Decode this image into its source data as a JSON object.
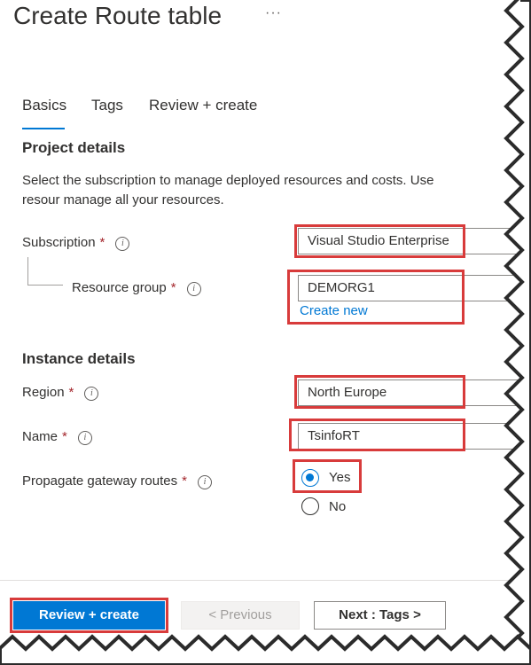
{
  "header": {
    "title": "Create Route table",
    "more": "···"
  },
  "tabs": [
    {
      "label": "Basics",
      "active": true
    },
    {
      "label": "Tags",
      "active": false
    },
    {
      "label": "Review + create",
      "active": false
    }
  ],
  "project": {
    "heading": "Project details",
    "description": "Select the subscription to manage deployed resources and costs. Use resour manage all your resources.",
    "subscription": {
      "label": "Subscription",
      "value": "Visual Studio Enterprise"
    },
    "resource_group": {
      "label": "Resource group",
      "value": "DEMORG1",
      "create_new": "Create new"
    }
  },
  "instance": {
    "heading": "Instance details",
    "region": {
      "label": "Region",
      "value": "North Europe"
    },
    "name": {
      "label": "Name",
      "value": "TsinfoRT"
    },
    "propagate": {
      "label": "Propagate gateway routes",
      "options": [
        "Yes",
        "No"
      ],
      "selected": "Yes"
    }
  },
  "common": {
    "required": "*",
    "info": "i"
  },
  "footer": {
    "review_create": "Review + create",
    "previous": "< Previous",
    "next": "Next : Tags >"
  },
  "colors": {
    "accent": "#0078d4",
    "highlight": "#d83b3b",
    "required": "#a4262c"
  }
}
